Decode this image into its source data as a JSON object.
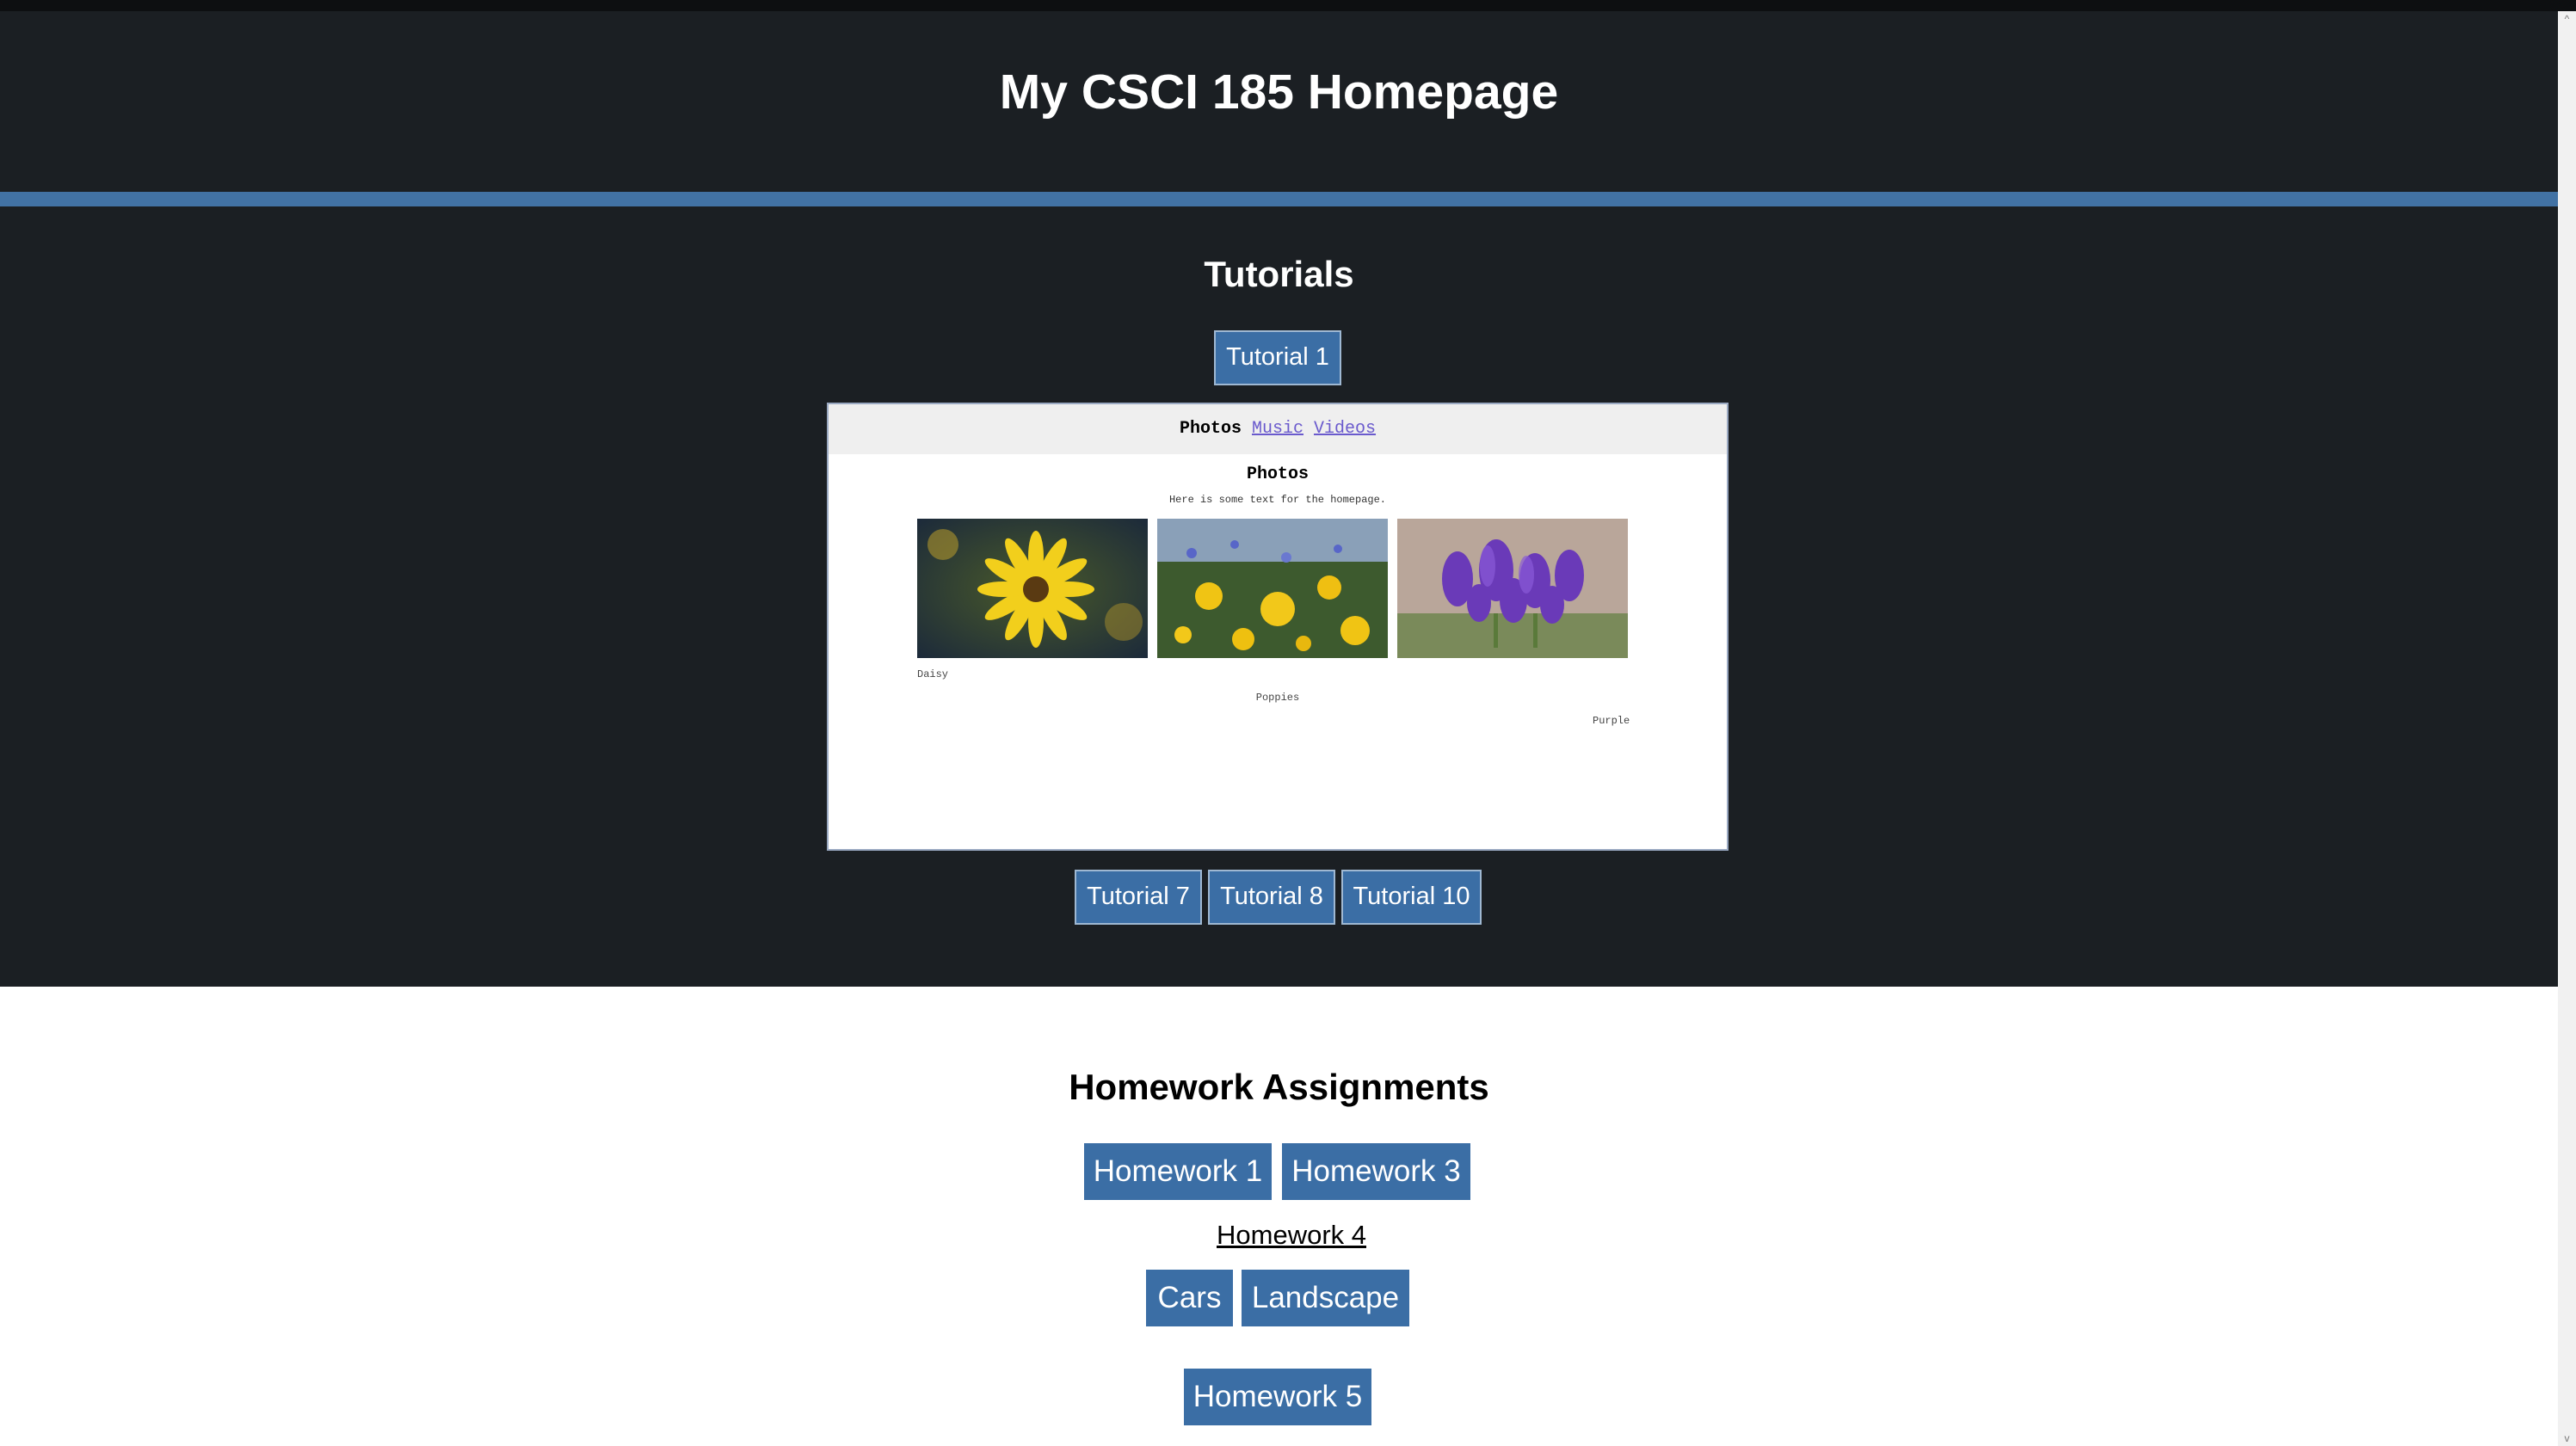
{
  "header": {
    "title": "My CSCI 185 Homepage"
  },
  "tutorials": {
    "heading": "Tutorials",
    "tutorial1": "Tutorial 1",
    "tutorial7": "Tutorial 7",
    "tutorial8": "Tutorial 8",
    "tutorial10": "Tutorial 10"
  },
  "preview": {
    "nav": {
      "active": "Photos",
      "music": "Music",
      "videos": "Videos"
    },
    "title": "Photos",
    "text": "Here is some text for the homepage.",
    "captions": {
      "daisy": "Daisy",
      "poppies": "Poppies",
      "purple": "Purple"
    }
  },
  "homework": {
    "heading": "Homework Assignments",
    "hw1": "Homework 1",
    "hw3": "Homework 3",
    "hw4": "Homework 4",
    "cars": "Cars",
    "landscape": "Landscape",
    "hw5": "Homework 5"
  },
  "scrollbar": {
    "up": "^",
    "down": "v"
  },
  "colors": {
    "header_bg": "#1b1f23",
    "accent": "#4272a4",
    "button": "#3b6ea5",
    "page_bg": "#ffffff"
  }
}
